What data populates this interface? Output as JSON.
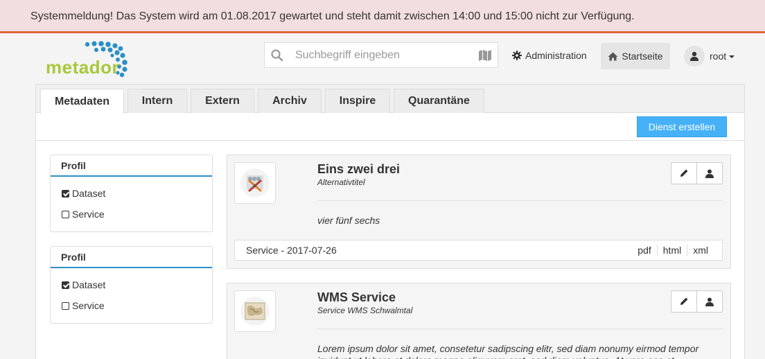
{
  "system_message": "Systemmeldung! Das System wird am 01.08.2017 gewartet und steht damit zwischen 14:00 und 15:00 nicht zur Verfügung.",
  "logo": {
    "text": "metador"
  },
  "search": {
    "placeholder": "Suchbegriff eingeben",
    "value": ""
  },
  "nav": {
    "admin_label": "Administration",
    "home_label": "Startseite",
    "user_label": "root"
  },
  "tabs": [
    {
      "label": "Metadaten",
      "active": true
    },
    {
      "label": "Intern",
      "active": false
    },
    {
      "label": "Extern",
      "active": false
    },
    {
      "label": "Archiv",
      "active": false
    },
    {
      "label": "Inspire",
      "active": false
    },
    {
      "label": "Quarantäne",
      "active": false
    }
  ],
  "toolbar": {
    "create_label": "Dienst erstellen"
  },
  "facets": [
    {
      "title": "Profil",
      "items": [
        {
          "label": "Dataset",
          "checked": true
        },
        {
          "label": "Service",
          "checked": false
        }
      ]
    },
    {
      "title": "Profil",
      "items": [
        {
          "label": "Dataset",
          "checked": true
        },
        {
          "label": "Service",
          "checked": false
        }
      ]
    }
  ],
  "records": [
    {
      "title": "Eins zwei drei",
      "subtitle": "Alternativtitel",
      "description": "vier fünf sechs",
      "footer": "Service - 2017-07-26",
      "links": [
        "pdf",
        "html",
        "xml"
      ],
      "thumbnail_icon": "tools-icon"
    },
    {
      "title": "WMS Service",
      "subtitle": "Service WMS Schwalmtal",
      "description": "Lorem ipsum dolor sit amet, consetetur sadipscing elitr, sed diam nonumy eirmod tempor invidunt ut labore et dolore magna aliquyam erat, sed diam voluptua. At vero eos et",
      "thumbnail_icon": "map-thumbnail-icon"
    }
  ],
  "colors": {
    "accent": "#46b1f7",
    "alert_bg": "#f2dede",
    "alert_border": "#e0643f",
    "logo_green": "#a8c83a",
    "logo_blue": "#2a8fc6"
  }
}
